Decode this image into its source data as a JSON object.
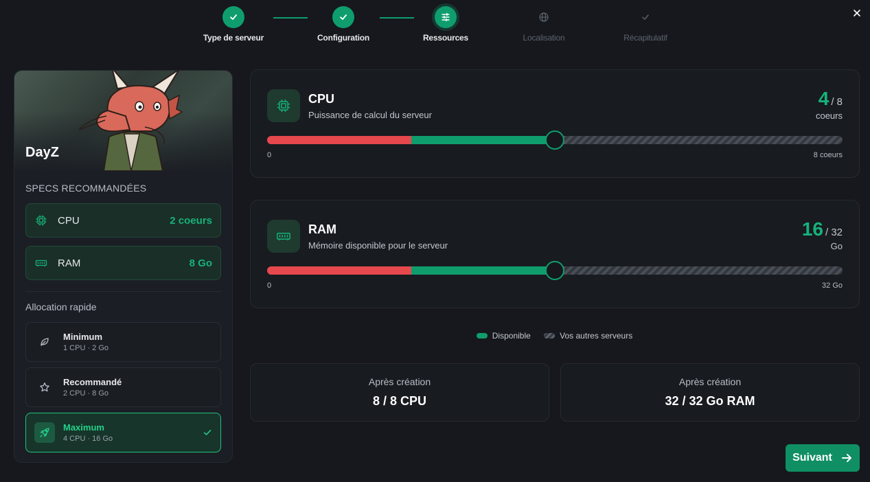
{
  "stepper": {
    "steps": [
      {
        "label": "Type de serveur",
        "state": "done",
        "icon": "check-icon"
      },
      {
        "label": "Configuration",
        "state": "done",
        "icon": "check-icon"
      },
      {
        "label": "Ressources",
        "state": "active",
        "icon": "sliders-icon"
      },
      {
        "label": "Localisation",
        "state": "todo",
        "icon": "globe-icon"
      },
      {
        "label": "Récapitulatif",
        "state": "todo",
        "icon": "check-icon"
      }
    ]
  },
  "game": {
    "title": "DayZ"
  },
  "specs": {
    "title": "SPECS RECOMMANDÉES",
    "items": [
      {
        "name": "CPU",
        "value": "2 coeurs",
        "icon": "cpu-chip-icon"
      },
      {
        "name": "RAM",
        "value": "8 Go",
        "icon": "ram-icon"
      }
    ]
  },
  "allocation": {
    "title": "Allocation rapide",
    "options": [
      {
        "name": "Minimum",
        "detail": "1 CPU · 2 Go",
        "icon": "leaf-icon",
        "selected": false
      },
      {
        "name": "Recommandé",
        "detail": "2 CPU · 8 Go",
        "icon": "star-icon",
        "selected": false
      },
      {
        "name": "Maximum",
        "detail": "4 CPU · 16 Go",
        "icon": "rocket-icon",
        "selected": true
      }
    ]
  },
  "resources": {
    "cpu": {
      "name": "CPU",
      "description": "Puissance de calcul du serveur",
      "value": "4",
      "max": "8",
      "unit": "coeurs",
      "min_label": "0",
      "max_label": "8 coeurs",
      "used_by_others_fraction": 0.25,
      "selected_fraction": 0.5
    },
    "ram": {
      "name": "RAM",
      "description": "Mémoire disponible pour le serveur",
      "value": "16",
      "max": "32",
      "unit": "Go",
      "min_label": "0",
      "max_label": "32 Go",
      "used_by_others_fraction": 0.25,
      "selected_fraction": 0.5
    }
  },
  "legend": {
    "available": "Disponible",
    "others": "Vos autres serveurs"
  },
  "summary": {
    "cpu": {
      "label": "Après création",
      "value": "8 / 8 CPU"
    },
    "ram": {
      "label": "Après création",
      "value": "32 / 32 Go RAM"
    }
  },
  "actions": {
    "next": "Suivant"
  },
  "colors": {
    "accent": "#0f9d6e",
    "accent_text": "#16b27a",
    "danger": "#e5484d",
    "background": "#16181d"
  }
}
